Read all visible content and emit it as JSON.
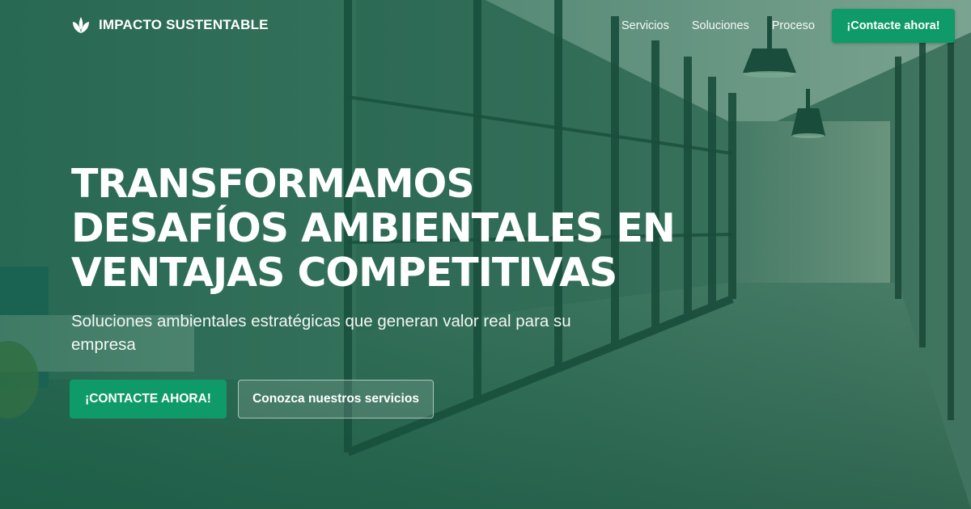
{
  "brand": {
    "name": "IMPACTO SUSTENTABLE",
    "logo_icon": "leaf-icon"
  },
  "nav": {
    "links": [
      "Servicios",
      "Soluciones",
      "Proceso"
    ],
    "cta_label": "¡Contacte ahora!"
  },
  "hero": {
    "title_lines": [
      "TRANSFORMAMOS",
      "DESAFÍOS AMBIENTALES EN",
      "VENTAJAS COMPETITIVAS"
    ],
    "subtitle": "Soluciones ambientales estratégicas que generan valor real para su empresa",
    "primary_button": "¡CONTACTE AHORA!",
    "secondary_button": "Conozca nuestros servicios"
  },
  "colors": {
    "accent": "#0f9a6a",
    "overlay": "#16644a"
  }
}
